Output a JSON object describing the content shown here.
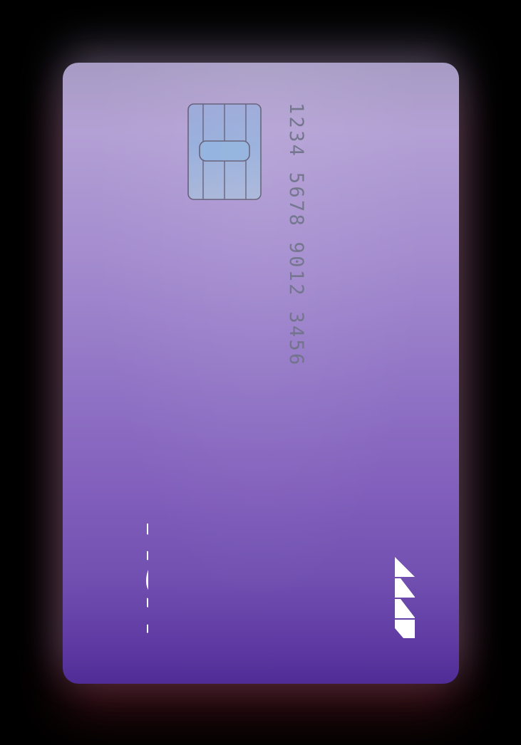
{
  "card": {
    "number": "1234 5678 9012 3456",
    "network": "VISA",
    "icons": {
      "chip": "chip-icon",
      "network_logo": "visa-logo",
      "issuer_logo": "triangles-logo"
    },
    "colors": {
      "top": "#a79cc4",
      "middle": "#9276c6",
      "bottom": "#4f2c96",
      "number_text": "#6b6e86",
      "logo": "#ffffff"
    }
  }
}
